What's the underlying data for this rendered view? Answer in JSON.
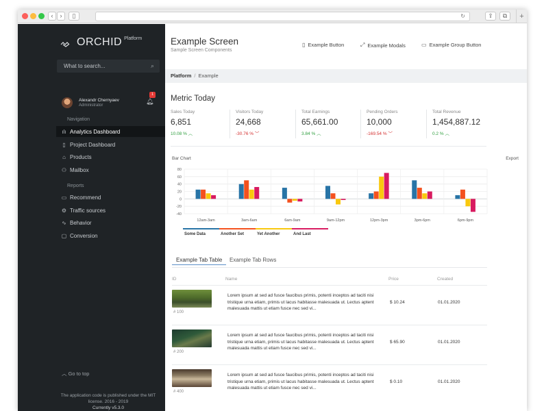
{
  "sidebar": {
    "brand": "ORCHID",
    "brand_sup": "Platform",
    "search_placeholder": "What to search...",
    "user": {
      "name": "Alexandr Chernyaev",
      "role": "Administrator",
      "notifications": "1"
    },
    "nav_heading": "Navigation",
    "nav_items": [
      {
        "label": "Analytics Dashboard",
        "icon": "bar-chart-icon"
      },
      {
        "label": "Project Dashboard",
        "icon": "document-icon"
      },
      {
        "label": "Products",
        "icon": "tag-icon"
      },
      {
        "label": "Mailbox",
        "icon": "people-icon"
      }
    ],
    "reports_heading": "Reports",
    "report_items": [
      {
        "label": "Recommend",
        "icon": "clipboard-icon"
      },
      {
        "label": "Traffic sources",
        "icon": "gears-icon"
      },
      {
        "label": "Behavior",
        "icon": "wave-icon"
      },
      {
        "label": "Conversion",
        "icon": "chat-icon"
      }
    ],
    "go_to_top": "Go to top",
    "footer_line1": "The application code is published under the MIT license. 2016 - 2019",
    "footer_version": "Currently v5.3.0"
  },
  "header": {
    "title": "Example Screen",
    "subtitle": "Sample Screen Components",
    "buttons": [
      "Example Button",
      "Example Modals",
      "Example Group Button"
    ]
  },
  "breadcrumb": {
    "root": "Platform",
    "current": "Example"
  },
  "metrics": {
    "title": "Metric Today",
    "items": [
      {
        "label": "Sales Today",
        "value": "6,851",
        "change": "10.08 %",
        "direction": "up"
      },
      {
        "label": "Visitors Today",
        "value": "24,668",
        "change": "-30.76 %",
        "direction": "down"
      },
      {
        "label": "Total Earnings",
        "value": "65,661.00",
        "change": "3.84 %",
        "direction": "up"
      },
      {
        "label": "Pending Orders",
        "value": "10,000",
        "change": "-169.54 %",
        "direction": "down"
      },
      {
        "label": "Total Revenue",
        "value": "1,454,887.12",
        "change": "0.2 %",
        "direction": "up"
      }
    ]
  },
  "chart": {
    "title": "Bar Chart",
    "export_label": "Export"
  },
  "chart_data": {
    "type": "bar",
    "categories": [
      "12am-3am",
      "3am-6am",
      "6am-9am",
      "9am-12pm",
      "12pm-3pm",
      "3pm-6pm",
      "6pm-9pm"
    ],
    "yticks": [
      80,
      60,
      40,
      20,
      0,
      -20,
      -40
    ],
    "ylim": [
      -40,
      80
    ],
    "series": [
      {
        "name": "Some Data",
        "color": "#2874a6",
        "values": [
          25,
          40,
          30,
          35,
          15,
          50,
          10
        ]
      },
      {
        "name": "Another Set",
        "color": "#f4511e",
        "values": [
          25,
          50,
          -10,
          15,
          20,
          30,
          25
        ]
      },
      {
        "name": "Yet Another",
        "color": "#f9c80e",
        "values": [
          15,
          25,
          -5,
          -15,
          60,
          15,
          -20
        ]
      },
      {
        "name": "And Last",
        "color": "#d81b60",
        "values": [
          10,
          32,
          -7,
          -3,
          70,
          20,
          -35
        ]
      }
    ],
    "legend": "bottom-left"
  },
  "tabs": [
    "Example Tab Table",
    "Example Tab Rows"
  ],
  "table": {
    "headers": [
      "ID",
      "Name",
      "Price",
      "Created"
    ],
    "rows": [
      {
        "id": "# 100",
        "name": "Lorem ipsum at sed ad fusce faucibus primis, potenti inceptos ad taciti nisi tristique urna etiam, primis ut lacus habitasse malesuada ut. Lectus aptent malesuada mattis ut etiam fusce nec sed vi...",
        "price": "$ 10.24",
        "created": "01.01.2020"
      },
      {
        "id": "# 200",
        "name": "Lorem ipsum at sed ad fusce faucibus primis, potenti inceptos ad taciti nisi tristique urna etiam, primis ut lacus habitasse malesuada ut. Lectus aptent malesuada mattis ut etiam fusce nec sed vi...",
        "price": "$ 65.90",
        "created": "01.01.2020"
      },
      {
        "id": "# 400",
        "name": "Lorem ipsum at sed ad fusce faucibus primis, potenti inceptos ad taciti nisi tristique urna etiam, primis ut lacus habitasse malesuada ut. Lectus aptent malesuada mattis ut etiam fusce nec sed vi...",
        "price": "$ 0.10",
        "created": "01.01.2020"
      }
    ]
  }
}
